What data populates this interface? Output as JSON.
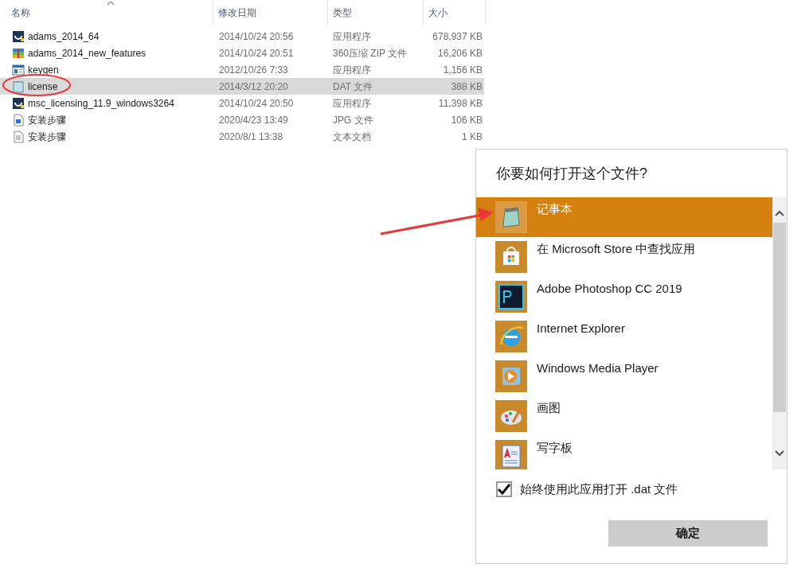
{
  "columns": [
    {
      "label": "名称",
      "sorted": true
    },
    {
      "label": "修改日期",
      "sorted": false
    },
    {
      "label": "类型",
      "sorted": false
    },
    {
      "label": "大小",
      "sorted": false
    }
  ],
  "files": [
    {
      "kind": "app",
      "name": "adams_2014_64",
      "date": "2014/10/24 20:56",
      "type": "应用程序",
      "size": "678,937 KB",
      "selected": false
    },
    {
      "kind": "zip",
      "name": "adams_2014_new_features",
      "date": "2014/10/24 20:51",
      "type": "360压缩 ZIP 文件",
      "size": "16,206 KB",
      "selected": false
    },
    {
      "kind": "window",
      "name": "keygen",
      "date": "2012/10/26 7:33",
      "type": "应用程序",
      "size": "1,156 KB",
      "selected": false
    },
    {
      "kind": "notepad",
      "name": "license",
      "date": "2014/3/12 20:20",
      "type": "DAT 文件",
      "size": "388 KB",
      "selected": true
    },
    {
      "kind": "app",
      "name": "msc_licensing_11.9_windows3264",
      "date": "2014/10/24 20:50",
      "type": "应用程序",
      "size": "11,398 KB",
      "selected": false
    },
    {
      "kind": "image",
      "name": "安装步骤",
      "date": "2020/4/23 13:49",
      "type": "JPG 文件",
      "size": "106 KB",
      "selected": false
    },
    {
      "kind": "text",
      "name": "安装步骤",
      "date": "2020/8/1 13:38",
      "type": "文本文档",
      "size": "1 KB",
      "selected": false
    }
  ],
  "dialog": {
    "title": "你要如何打开这个文件?",
    "apps": [
      {
        "kind": "notepad",
        "name": "记事本",
        "selected": true
      },
      {
        "kind": "store",
        "name": "在 Microsoft Store 中查找应用",
        "selected": false
      },
      {
        "kind": "photoshop",
        "name": "Adobe Photoshop CC 2019",
        "selected": false
      },
      {
        "kind": "ie",
        "name": "Internet Explorer",
        "selected": false
      },
      {
        "kind": "player",
        "name": "Windows Media Player",
        "selected": false
      },
      {
        "kind": "paint",
        "name": "画图",
        "selected": false
      },
      {
        "kind": "wordpad",
        "name": "写字板",
        "selected": false
      }
    ],
    "always_use": {
      "label": "始终使用此应用打开 .dat 文件",
      "checked": true
    },
    "ok_button": "确定"
  }
}
